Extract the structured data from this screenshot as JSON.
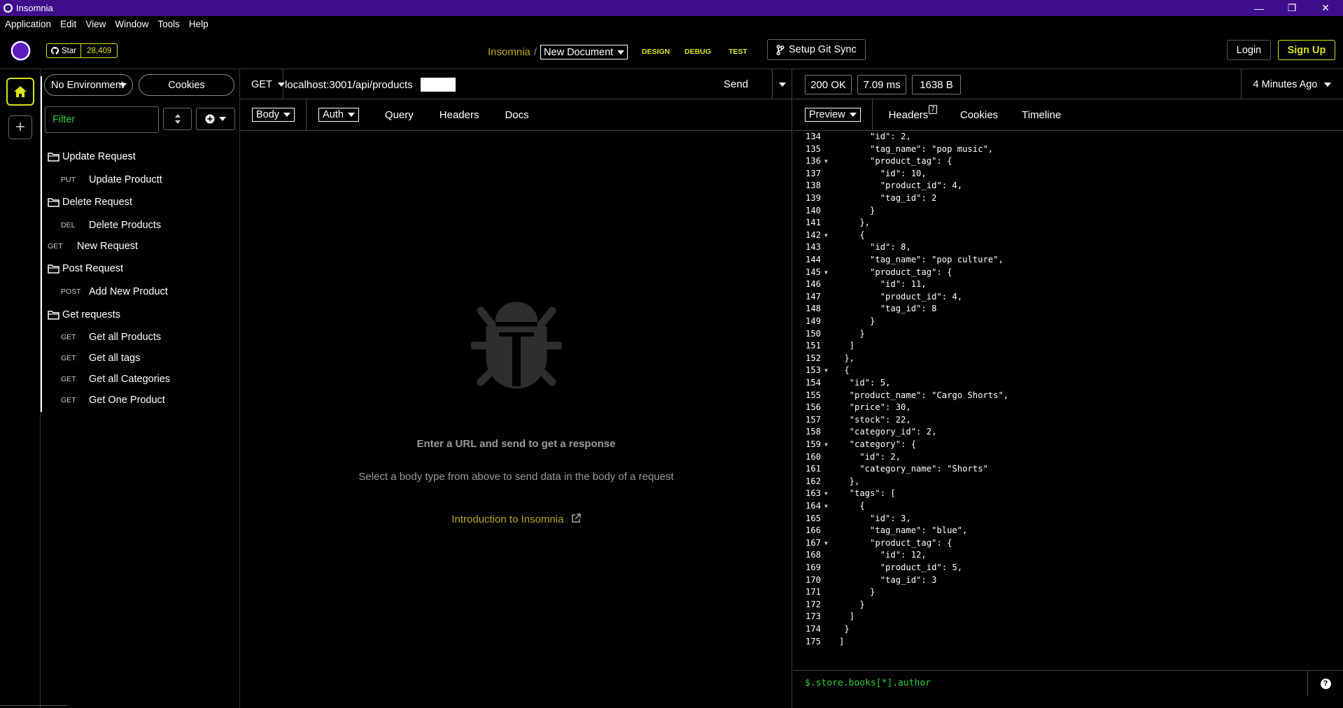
{
  "window": {
    "title": "Insomnia",
    "controls": [
      "—",
      "❐",
      "✕"
    ]
  },
  "menu": [
    "Application",
    "Edit",
    "View",
    "Window",
    "Tools",
    "Help"
  ],
  "header": {
    "star_label": "Star",
    "star_count": "28,409",
    "app_name": "Insomnia",
    "separator": "/",
    "document": "New Document",
    "tabs": [
      "DESIGN",
      "DEBUG",
      "TEST"
    ],
    "git_sync": "Setup Git Sync",
    "login": "Login",
    "signup": "Sign Up"
  },
  "sidebar": {
    "environment": "No Environment",
    "cookies": "Cookies",
    "filter_placeholder": "Filter",
    "items": [
      {
        "type": "folder",
        "label": "Update Request"
      },
      {
        "type": "request",
        "method": "PUT",
        "label": "Update Productt"
      },
      {
        "type": "folder",
        "label": "Delete Request"
      },
      {
        "type": "request",
        "method": "DEL",
        "label": "Delete Products"
      },
      {
        "type": "request",
        "method": "GET",
        "label": "New Request"
      },
      {
        "type": "folder",
        "label": "Post Request"
      },
      {
        "type": "request",
        "method": "POST",
        "label": "Add New Product"
      },
      {
        "type": "folder",
        "label": "Get requests"
      },
      {
        "type": "request",
        "method": "GET",
        "label": "Get all Products"
      },
      {
        "type": "request",
        "method": "GET",
        "label": "Get all tags"
      },
      {
        "type": "request",
        "method": "GET",
        "label": "Get all Categories"
      },
      {
        "type": "request",
        "method": "GET",
        "label": "Get One Product"
      }
    ]
  },
  "request": {
    "method": "GET",
    "url": "localhost:3001/api/products",
    "send": "Send",
    "tabs": {
      "body": "Body",
      "auth": "Auth",
      "query": "Query",
      "headers": "Headers",
      "docs": "Docs"
    },
    "empty_title": "Enter a URL and send to get a response",
    "empty_sub": "Select a body type from above to send data in the body of a request",
    "intro_link": "Introduction to Insomnia"
  },
  "response": {
    "status": "200 OK",
    "time": "7.09 ms",
    "size": "1638 B",
    "time_ago": "4 Minutes Ago",
    "tabs": {
      "preview": "Preview",
      "headers": "Headers",
      "headers_count": "7",
      "cookies": "Cookies",
      "timeline": "Timeline"
    },
    "filter": "$.store.books[*].author",
    "lines": [
      {
        "n": "134",
        "fold": false,
        "text": "      \"id\": 2,"
      },
      {
        "n": "135",
        "fold": false,
        "text": "      \"tag_name\": \"pop music\","
      },
      {
        "n": "136",
        "fold": true,
        "text": "      \"product_tag\": {"
      },
      {
        "n": "137",
        "fold": false,
        "text": "        \"id\": 10,"
      },
      {
        "n": "138",
        "fold": false,
        "text": "        \"product_id\": 4,"
      },
      {
        "n": "139",
        "fold": false,
        "text": "        \"tag_id\": 2"
      },
      {
        "n": "140",
        "fold": false,
        "text": "      }"
      },
      {
        "n": "141",
        "fold": false,
        "text": "    },"
      },
      {
        "n": "142",
        "fold": true,
        "text": "    {"
      },
      {
        "n": "143",
        "fold": false,
        "text": "      \"id\": 8,"
      },
      {
        "n": "144",
        "fold": false,
        "text": "      \"tag_name\": \"pop culture\","
      },
      {
        "n": "145",
        "fold": true,
        "text": "      \"product_tag\": {"
      },
      {
        "n": "146",
        "fold": false,
        "text": "        \"id\": 11,"
      },
      {
        "n": "147",
        "fold": false,
        "text": "        \"product_id\": 4,"
      },
      {
        "n": "148",
        "fold": false,
        "text": "        \"tag_id\": 8"
      },
      {
        "n": "149",
        "fold": false,
        "text": "      }"
      },
      {
        "n": "150",
        "fold": false,
        "text": "    }"
      },
      {
        "n": "151",
        "fold": false,
        "text": "  ]"
      },
      {
        "n": "152",
        "fold": false,
        "text": " },"
      },
      {
        "n": "153",
        "fold": true,
        "text": " {"
      },
      {
        "n": "154",
        "fold": false,
        "text": "  \"id\": 5,"
      },
      {
        "n": "155",
        "fold": false,
        "text": "  \"product_name\": \"Cargo Shorts\","
      },
      {
        "n": "156",
        "fold": false,
        "text": "  \"price\": 30,"
      },
      {
        "n": "157",
        "fold": false,
        "text": "  \"stock\": 22,"
      },
      {
        "n": "158",
        "fold": false,
        "text": "  \"category_id\": 2,"
      },
      {
        "n": "159",
        "fold": true,
        "text": "  \"category\": {"
      },
      {
        "n": "160",
        "fold": false,
        "text": "    \"id\": 2,"
      },
      {
        "n": "161",
        "fold": false,
        "text": "    \"category_name\": \"Shorts\""
      },
      {
        "n": "162",
        "fold": false,
        "text": "  },"
      },
      {
        "n": "163",
        "fold": true,
        "text": "  \"tags\": ["
      },
      {
        "n": "164",
        "fold": true,
        "text": "    {"
      },
      {
        "n": "165",
        "fold": false,
        "text": "      \"id\": 3,"
      },
      {
        "n": "166",
        "fold": false,
        "text": "      \"tag_name\": \"blue\","
      },
      {
        "n": "167",
        "fold": true,
        "text": "      \"product_tag\": {"
      },
      {
        "n": "168",
        "fold": false,
        "text": "        \"id\": 12,"
      },
      {
        "n": "169",
        "fold": false,
        "text": "        \"product_id\": 5,"
      },
      {
        "n": "170",
        "fold": false,
        "text": "        \"tag_id\": 3"
      },
      {
        "n": "171",
        "fold": false,
        "text": "      }"
      },
      {
        "n": "172",
        "fold": false,
        "text": "    }"
      },
      {
        "n": "173",
        "fold": false,
        "text": "  ]"
      },
      {
        "n": "174",
        "fold": false,
        "text": " }"
      },
      {
        "n": "175",
        "fold": false,
        "text": "]"
      }
    ]
  },
  "colors": {
    "titlebar": "#3e0d8a",
    "accent": "#d7e315",
    "link": "#b6a90f",
    "filter_text": "#2bd13b"
  },
  "icons": [
    "insomnia-logo-icon",
    "github-icon",
    "git-branch-icon",
    "home-icon",
    "plus-icon",
    "folder-icon",
    "sort-icon",
    "add-circle-icon",
    "bug-icon",
    "external-link-icon",
    "help-icon"
  ]
}
